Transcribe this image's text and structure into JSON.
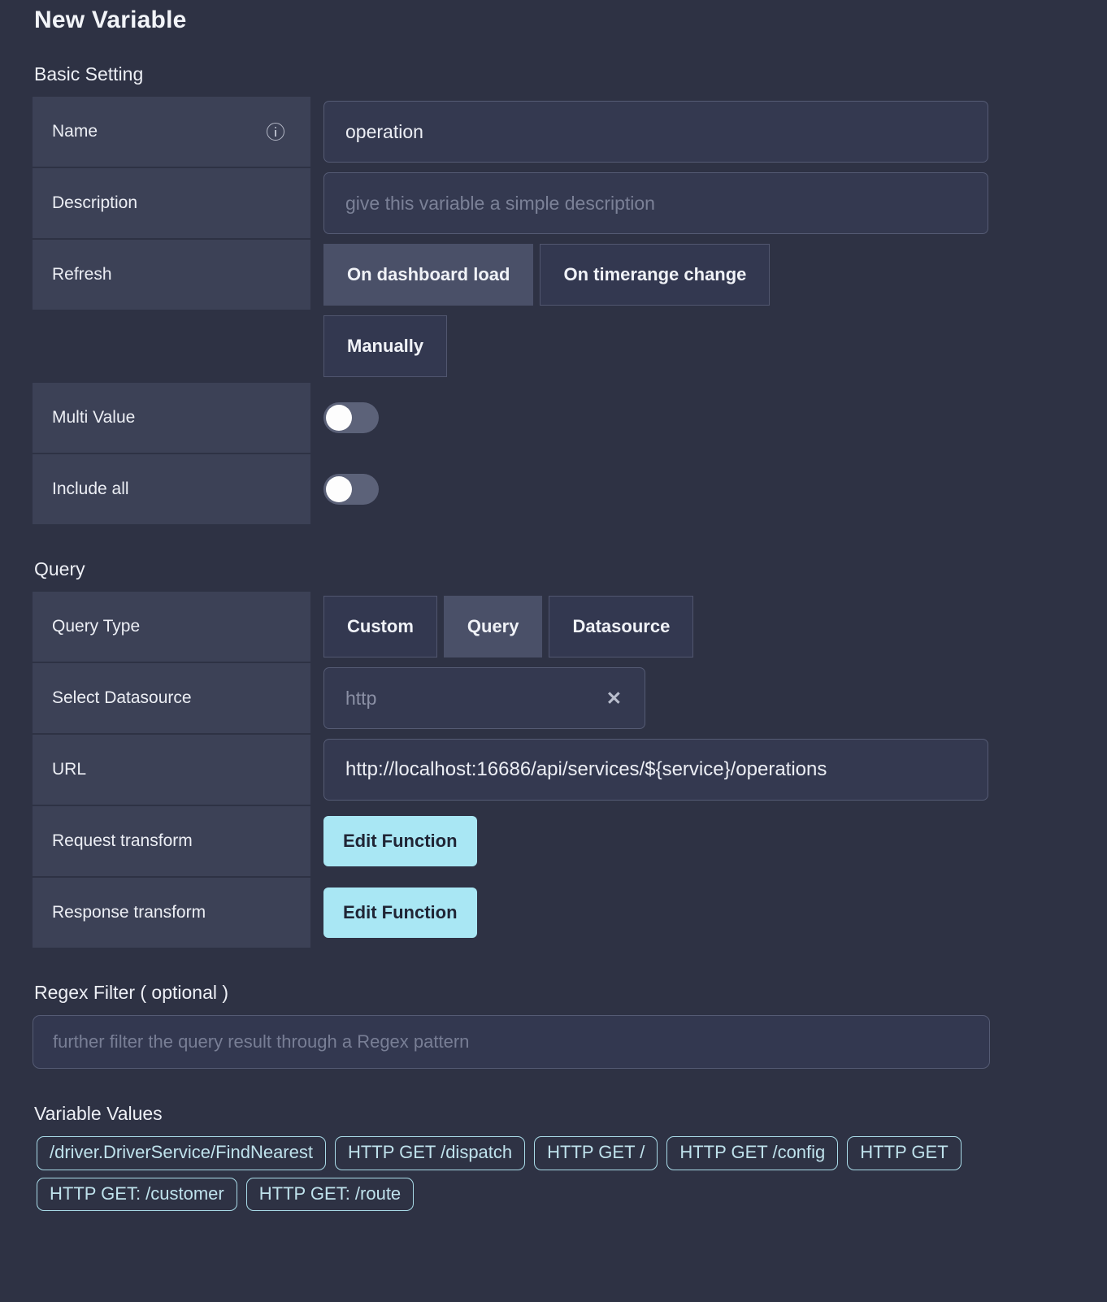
{
  "page": {
    "title": "New Variable"
  },
  "basic": {
    "section_title": "Basic Setting",
    "name": {
      "label": "Name",
      "info_icon": "info-icon",
      "value": "operation"
    },
    "description": {
      "label": "Description",
      "value": "",
      "placeholder": "give this variable a simple description"
    },
    "refresh": {
      "label": "Refresh",
      "options": [
        "On dashboard load",
        "On timerange change",
        "Manually"
      ],
      "selected": "On dashboard load"
    },
    "multi_value": {
      "label": "Multi Value",
      "enabled": false
    },
    "include_all": {
      "label": "Include all",
      "enabled": false
    }
  },
  "query": {
    "section_title": "Query",
    "query_type": {
      "label": "Query Type",
      "options": [
        "Custom",
        "Query",
        "Datasource"
      ],
      "selected": "Query"
    },
    "select_datasource": {
      "label": "Select Datasource",
      "value": "http",
      "clear_icon": "close-x-icon"
    },
    "url": {
      "label": "URL",
      "value": "http://localhost:16686/api/services/${service}/operations"
    },
    "request_transform": {
      "label": "Request transform",
      "button": "Edit Function"
    },
    "response_transform": {
      "label": "Response transform",
      "button": "Edit Function"
    }
  },
  "regex": {
    "section_title": "Regex Filter ( optional )",
    "value": "",
    "placeholder": "further filter the query result through a Regex pattern"
  },
  "variable_values": {
    "section_title": "Variable Values",
    "tags": [
      "/driver.DriverService/FindNearest",
      "HTTP GET /dispatch",
      "HTTP GET /",
      "HTTP GET /config",
      "HTTP GET",
      "HTTP GET: /customer",
      "HTTP GET: /route"
    ]
  },
  "colors": {
    "background": "#2e3244",
    "label_cell": "#3c4156",
    "input_bg": "#343950",
    "input_border": "#555b74",
    "selected_tab": "#4a5068",
    "accent_button": "#a9e7f4",
    "tag_border": "#a9dbe8",
    "tag_text": "#bfe2ec"
  }
}
